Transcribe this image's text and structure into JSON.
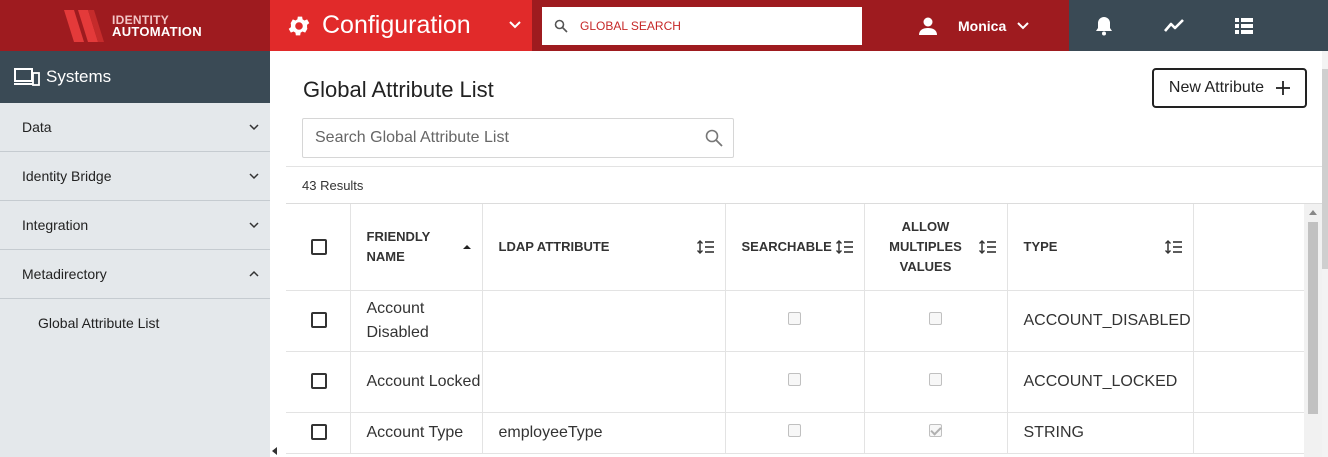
{
  "brand": {
    "line1": "IDENTITY",
    "line2": "AUTOMATION",
    "color": "#9e1b1f"
  },
  "header": {
    "module_title": "Configuration",
    "module_color": "#e12a2a",
    "search_placeholder": "GLOBAL SEARCH",
    "user_name": "Monica",
    "icons": [
      "bell-icon",
      "activity-icon",
      "list-icon"
    ]
  },
  "sidebar": {
    "title": "Systems",
    "items": [
      {
        "label": "Data",
        "expanded": false
      },
      {
        "label": "Identity Bridge",
        "expanded": false
      },
      {
        "label": "Integration",
        "expanded": false
      },
      {
        "label": "Metadirectory",
        "expanded": true
      }
    ],
    "sub_items": [
      {
        "label": "Global Attribute List"
      }
    ]
  },
  "main": {
    "title": "Global Attribute List",
    "new_button_label": "New Attribute",
    "search_placeholder": "Search Global Attribute List",
    "results_text": "43 Results",
    "columns": {
      "friendly_name": "FRIENDLY NAME",
      "ldap_attribute": "LDAP ATTRIBUTE",
      "searchable": "SEARCHABLE",
      "allow_multiples": "ALLOW MULTIPLES VALUES",
      "type": "TYPE"
    },
    "rows": [
      {
        "friendly_name": "Account Disabled",
        "ldap_attribute": "",
        "searchable": false,
        "allow_multiples": false,
        "type": "ACCOUNT_DISABLED"
      },
      {
        "friendly_name": "Account Locked",
        "ldap_attribute": "",
        "searchable": false,
        "allow_multiples": false,
        "type": "ACCOUNT_LOCKED"
      },
      {
        "friendly_name": "Account Type",
        "ldap_attribute": "employeeType",
        "searchable": false,
        "allow_multiples": true,
        "type": "STRING"
      }
    ]
  }
}
